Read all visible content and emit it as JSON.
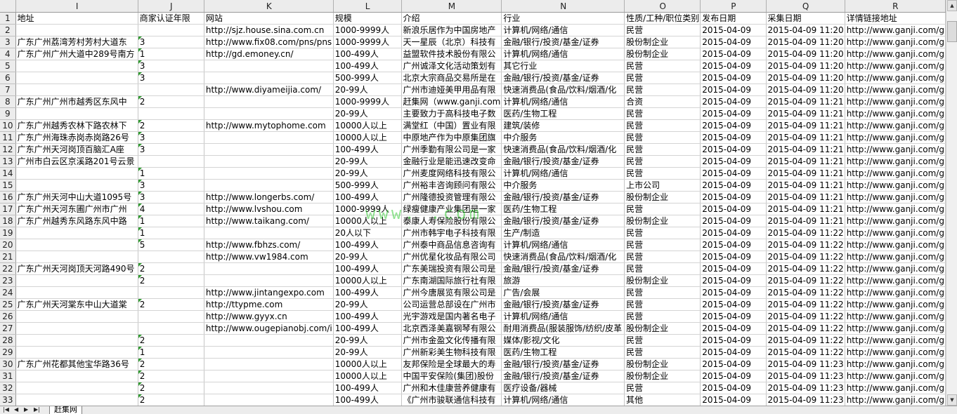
{
  "sheet": {
    "columns": [
      "I",
      "J",
      "K",
      "L",
      "M",
      "N",
      "O",
      "P",
      "Q",
      "R"
    ],
    "header_row": [
      "地址",
      "商家认证年限",
      "网站",
      "规模",
      "介绍",
      "行业",
      "性质/工种/职位类别",
      "发布日期",
      "采集日期",
      "详情链接地址"
    ],
    "rows": [
      {
        "n": "2",
        "c": [
          "",
          "",
          "http://sjz.house.sina.com.cn",
          "1000-9999人",
          "新浪乐居作为中国房地产",
          "计算机/网络/通信",
          "民营",
          "2015-04-09",
          "2015-04-09 11:20",
          "http://www.ganji.com/g"
        ]
      },
      {
        "n": "3",
        "c": [
          "广东广州荔湾芳村芳村大道东",
          "3",
          "http://www.fix08.com/pns/pns",
          "1000-9999人",
          "天一星辰（北京）科技有",
          "金融/银行/投资/基金/证券",
          "股份制企业",
          "2015-04-09",
          "2015-04-09 11:20",
          "http://www.ganji.com/g"
        ]
      },
      {
        "n": "4",
        "c": [
          "广东广州广州大道中289号南方",
          "1",
          "http://gd.emoney.cn/",
          "100-499人",
          "益盟软件技术股份有限公",
          "计算机/网络/通信",
          "股份制企业",
          "2015-04-09",
          "2015-04-09 11:20",
          "http://www.ganji.com/g"
        ]
      },
      {
        "n": "5",
        "c": [
          "",
          "3",
          "",
          "100-499人",
          "广州诚泽文化活动策划有",
          "其它行业",
          "民营",
          "2015-04-09",
          "2015-04-09 11:20",
          "http://www.ganji.com/g"
        ]
      },
      {
        "n": "6",
        "c": [
          "",
          "3",
          "",
          "500-999人",
          "北京大宗商品交易所是在",
          "金融/银行/投资/基金/证券",
          "民营",
          "2015-04-09",
          "2015-04-09 11:20",
          "http://www.ganji.com/g"
        ]
      },
      {
        "n": "7",
        "c": [
          "",
          "",
          "http://www.diyameijia.com/",
          "20-99人",
          "广州市迪娅美甲用品有限",
          "快速消费品(食品/饮料/烟酒/化",
          "民营",
          "2015-04-09",
          "2015-04-09 11:20",
          "http://www.ganji.com/g"
        ]
      },
      {
        "n": "8",
        "c": [
          "广东广州广州市越秀区东风中",
          "2",
          "",
          "1000-9999人",
          "赶集网（www.ganji.com",
          "计算机/网络/通信",
          "合资",
          "2015-04-09",
          "2015-04-09 11:21",
          "http://www.ganji.com/g"
        ]
      },
      {
        "n": "9",
        "c": [
          "",
          "",
          "",
          "20-99人",
          "主要致力于高科技电子数",
          "医药/生物工程",
          "民营",
          "2015-04-09",
          "2015-04-09 11:21",
          "http://www.ganji.com/g"
        ]
      },
      {
        "n": "10",
        "c": [
          "广东广州越秀农林下路农林下",
          "2",
          "http://www.mytophome.com",
          "10000人以上",
          "满堂红（中国）置业有限",
          "建筑/装修",
          "民营",
          "2015-04-09",
          "2015-04-09 11:21",
          "http://www.ganji.com/g"
        ]
      },
      {
        "n": "11",
        "c": [
          "广东广州海珠赤岗赤岗路26号",
          "3",
          "",
          "10000人以上",
          "中原地产作为中原集团旗",
          "中介服务",
          "民营",
          "2015-04-09",
          "2015-04-09 11:21",
          "http://www.ganji.com/g"
        ]
      },
      {
        "n": "12",
        "c": [
          "广东广州天河岗顶百脑汇A座",
          "3",
          "",
          "100-499人",
          "广州季勤有限公司是一家",
          "快速消费品(食品/饮料/烟酒/化",
          "民营",
          "2015-04-09",
          "2015-04-09 11:21",
          "http://www.ganji.com/g"
        ]
      },
      {
        "n": "13",
        "c": [
          "广州市白云区京溪路201号云景",
          "",
          "",
          "20-99人",
          "金融行业是能迅速改变命",
          "金融/银行/投资/基金/证券",
          "民营",
          "2015-04-09",
          "2015-04-09 11:21",
          "http://www.ganji.com/g"
        ]
      },
      {
        "n": "14",
        "c": [
          "",
          "1",
          "",
          "20-99人",
          "广州麦度网络科技有限公",
          "计算机/网络/通信",
          "民营",
          "2015-04-09",
          "2015-04-09 11:21",
          "http://www.ganji.com/g"
        ]
      },
      {
        "n": "15",
        "c": [
          "",
          "3",
          "",
          "500-999人",
          "广州裕丰咨询顾问有限公",
          "中介服务",
          "上市公司",
          "2015-04-09",
          "2015-04-09 11:21",
          "http://www.ganji.com/g"
        ]
      },
      {
        "n": "16",
        "c": [
          "广东广州天河中山大道1095号",
          "3",
          "http://www.longerbs.com/",
          "100-499人",
          "广州隆德投资管理有限公",
          "金融/银行/投资/基金/证券",
          "股份制企业",
          "2015-04-09",
          "2015-04-09 11:21",
          "http://www.ganji.com/g"
        ]
      },
      {
        "n": "17",
        "c": [
          "广东广州天河东圃广州市广州",
          "4",
          "http://www.lvshou.com",
          "1000-9999人",
          "绿瘦健康产业集团是一家",
          "医药/生物工程",
          "民营",
          "2015-04-09",
          "2015-04-09 11:21",
          "http://www.ganji.com/g"
        ]
      },
      {
        "n": "18",
        "c": [
          "广东广州越秀东风路东风中路",
          "1",
          "http://www.taikang.com/",
          "10000人以上",
          "泰康人寿保险股份有限公",
          "金融/银行/投资/基金/证券",
          "股份制企业",
          "2015-04-09",
          "2015-04-09 11:21",
          "http://www.ganji.com/g"
        ]
      },
      {
        "n": "19",
        "c": [
          "",
          "1",
          "",
          "20人以下",
          "广州市韩宇电子科技有限",
          "生产/制造",
          "民营",
          "2015-04-09",
          "2015-04-09 11:22",
          "http://www.ganji.com/g"
        ]
      },
      {
        "n": "20",
        "c": [
          "",
          "5",
          "http://www.fbhzs.com/",
          "100-499人",
          "广州泰中商品信息咨询有",
          "计算机/网络/通信",
          "民营",
          "2015-04-09",
          "2015-04-09 11:22",
          "http://www.ganji.com/g"
        ]
      },
      {
        "n": "21",
        "c": [
          "",
          "",
          "http://www.vw1984.com",
          "20-99人",
          "广州优星化妆品有限公司",
          "快速消费品(食品/饮料/烟酒/化",
          "民营",
          "2015-04-09",
          "2015-04-09 11:22",
          "http://www.ganji.com/g"
        ]
      },
      {
        "n": "22",
        "c": [
          "广东广州天河岗顶天河路490号",
          "2",
          "",
          "100-499人",
          "广东美瑞投资有限公司是",
          "金融/银行/投资/基金/证券",
          "民营",
          "2015-04-09",
          "2015-04-09 11:22",
          "http://www.ganji.com/g"
        ]
      },
      {
        "n": "23",
        "c": [
          "",
          "2",
          "",
          "10000人以上",
          "广东南湖国际旅行社有限",
          "旅游",
          "股份制企业",
          "2015-04-09",
          "2015-04-09 11:22",
          "http://www.ganji.com/g"
        ]
      },
      {
        "n": "24",
        "c": [
          "",
          "",
          "http://www.jintangexpo.com",
          "100-499人",
          "广州今唐展览有限公司是",
          "广告/会展",
          "民营",
          "2015-04-09",
          "2015-04-09 11:22",
          "http://www.ganji.com/g"
        ]
      },
      {
        "n": "25",
        "c": [
          "广东广州天河棠东中山大道棠",
          "2",
          "http://ttypme.com",
          "20-99人",
          "公司运营总部设在广州市",
          "金融/银行/投资/基金/证券",
          "民营",
          "2015-04-09",
          "2015-04-09 11:22",
          "http://www.ganji.com/g"
        ]
      },
      {
        "n": "26",
        "c": [
          "",
          "",
          "http://www.gyyx.cn",
          "100-499人",
          "光宇游戏是国内著名电子",
          "计算机/网络/通信",
          "民营",
          "2015-04-09",
          "2015-04-09 11:22",
          "http://www.ganji.com/g"
        ]
      },
      {
        "n": "27",
        "c": [
          "",
          "",
          "http://www.ougepianobj.com/i",
          "100-499人",
          "北京西泽美嘉钢琴有限公",
          "耐用消费品(服装服饰/纺织/皮革",
          "股份制企业",
          "2015-04-09",
          "2015-04-09 11:22",
          "http://www.ganji.com/g"
        ]
      },
      {
        "n": "28",
        "c": [
          "",
          "2",
          "",
          "20-99人",
          "广州市金盈文化传播有限",
          "媒体/影视/文化",
          "民营",
          "2015-04-09",
          "2015-04-09 11:22",
          "http://www.ganji.com/g"
        ]
      },
      {
        "n": "29",
        "c": [
          "",
          "1",
          "",
          "20-99人",
          "广州新彩美生物科技有限",
          "医药/生物工程",
          "民营",
          "2015-04-09",
          "2015-04-09 11:22",
          "http://www.ganji.com/g"
        ]
      },
      {
        "n": "30",
        "c": [
          "广东广州花都其他宝华路36号",
          "2",
          "",
          "10000人以上",
          "友邦保险是全球最大的寿",
          "金融/银行/投资/基金/证券",
          "股份制企业",
          "2015-04-09",
          "2015-04-09 11:23",
          "http://www.ganji.com/g"
        ]
      },
      {
        "n": "31",
        "c": [
          "",
          "2",
          "",
          "10000人以上",
          "中国平安保险(集团)股份",
          "金融/银行/投资/基金/证券",
          "股份制企业",
          "2015-04-09",
          "2015-04-09 11:23",
          "http://www.ganji.com/g"
        ]
      },
      {
        "n": "32",
        "c": [
          "",
          "2",
          "",
          "100-499人",
          "广州和木佳康营养健康有",
          "医疗设备/器械",
          "民营",
          "2015-04-09",
          "2015-04-09 11:23",
          "http://www.ganji.com/g"
        ]
      },
      {
        "n": "33",
        "c": [
          "",
          "2",
          "",
          "100-499人",
          "《广州市骏联通信科技有",
          "计算机/网络/通信",
          "其他",
          "2015-04-09",
          "2015-04-09 11:23",
          "http://www.ganji.com/g"
        ]
      }
    ]
  },
  "tabs": {
    "active": "赶集网"
  },
  "watermark": "www.          .com",
  "colors": {
    "header_bg": "#ececec",
    "grid_line": "#d4d4d4",
    "error_triangle": "#2f9a2f"
  }
}
